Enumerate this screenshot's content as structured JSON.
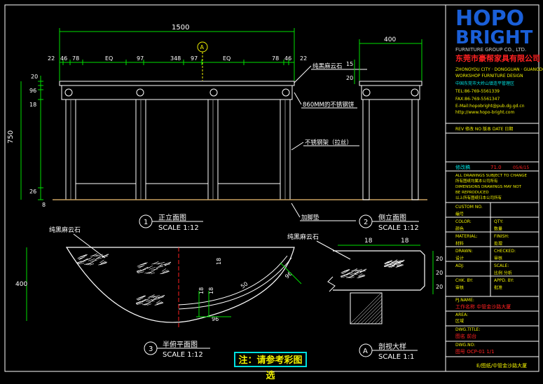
{
  "logo": {
    "brand_top": "HOPO",
    "brand_bottom": "BRIGHT",
    "company_en": "FURNITURE GROUP CO., LTD.",
    "company_cn": "东莞市豪帮家具有限公司"
  },
  "title_block": {
    "info_lines": [
      "ZHONGYOU CITY · DONGGUAN · GUANGDONG",
      "WORKSHOP FURNITURE DESIGN",
      "中国东莞市大岭山镇连平管理区",
      "TEL:86-769-5561339",
      "FAX:86-769-5561347",
      "E-Mail:hopobright@pub.dg.gd.cn",
      "http://www.hopo-bright.com"
    ],
    "rev_row": "REV  修改   NO 版本   DATE 日期",
    "design_row_label": "修改稿",
    "design_row_value": "71.0",
    "design_row_date": "05/6/15",
    "spec_lines": [
      "ALL DRAWINGS SUBJECT TO CHANGE",
      "所有图纸均属本公司所有",
      "DIMENSIONS DRAWINGS MAY NOT",
      "BE REPRODUCED",
      "以上所有图纸归本公司所有"
    ],
    "rows": [
      {
        "label": "CUSTOM NO.",
        "value": ""
      },
      {
        "label": "编号",
        "value": ""
      },
      {
        "label": "COLOR:",
        "value": "QTY:"
      },
      {
        "label": "颜色",
        "value": "数量"
      },
      {
        "label": "MATERIAL:",
        "value": "FINISH:"
      },
      {
        "label": "材料",
        "value": "处理"
      },
      {
        "label": "DRAWN:",
        "value": "CHECKED:"
      },
      {
        "label": "设计",
        "value": "审核"
      },
      {
        "label": "ADJ:",
        "value": "SCALE:"
      },
      {
        "label": "",
        "value": "比例        分析"
      },
      {
        "label": "CHK. BY:",
        "value": "APPD. BY:"
      },
      {
        "label": "审核",
        "value": "批准"
      }
    ],
    "project_label": "PJ.NAME:",
    "project_value": "工作名称    中管金沙路大厦",
    "area_label": "AREA:",
    "area_value": "区域",
    "dwg_title_label": "DWG.TITLE:",
    "dwg_title_value": "图名        前台",
    "dwg_no_label": "DWG.NO:",
    "dwg_no_value": "图号        OCP-01     1/1",
    "path_text": "E/图纸/中管金沙路大厦"
  },
  "front_view": {
    "overall": "1500",
    "top_dims": [
      "22",
      "46",
      "78",
      "EQ",
      "97",
      "348",
      "97",
      "EQ",
      "78",
      "46",
      "22"
    ],
    "left_dims": [
      "20",
      "96",
      "18",
      "750",
      "26",
      "8"
    ],
    "callouts": [
      "纯黑麻云石",
      "860MM的不锈钢饼",
      "不锈钢架（拉丝）",
      "加脚垫"
    ],
    "marker_A": "A",
    "caption_no": "1",
    "caption_title": "正立面图",
    "caption_scale": "SCALE 1:12"
  },
  "side_view": {
    "width": "400",
    "left_dims": [
      "15",
      "20"
    ],
    "caption_no": "2",
    "caption_title": "侧立面图",
    "caption_scale": "SCALE 1:12"
  },
  "plan_view": {
    "label_stone": "纯黑麻云石",
    "depth": "400",
    "dims": [
      "18",
      "18",
      "18",
      "96",
      "96",
      "50"
    ],
    "caption_no": "3",
    "caption_title": "半俯平面图",
    "caption_scale": "SCALE 1:12"
  },
  "detail_view": {
    "label_stone": "纯黑麻云石",
    "dims": [
      "18",
      "18",
      "20",
      "20",
      "20"
    ],
    "caption_no": "A",
    "caption_title": "剖视大样",
    "caption_scale": "SCALE 1:1"
  },
  "note": "注：请参考彩图选",
  "colors": {
    "line": "#ffffff",
    "dim": "#00e000",
    "text_yellow": "#f0f000",
    "cyan": "#00e0e0",
    "red": "#ff2020",
    "brand_blue": "#1a5fd8"
  }
}
